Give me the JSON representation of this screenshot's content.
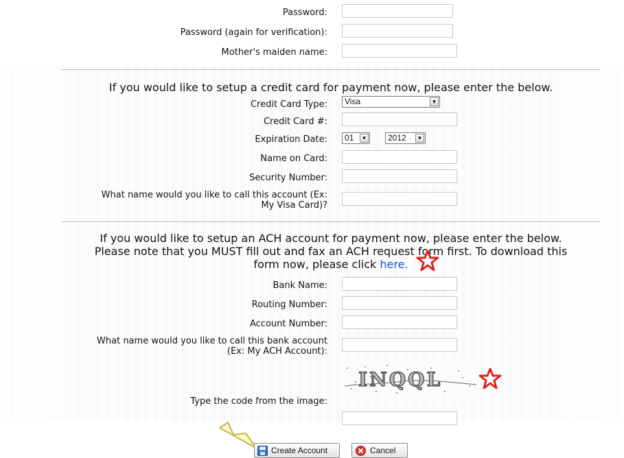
{
  "account": {
    "password_label": "Password:",
    "password_again_label": "Password (again for verification):",
    "maiden_label": "Mother's maiden name:"
  },
  "credit_card": {
    "intro": "If you would like to setup a credit card for payment now, please enter the below.",
    "type_label": "Credit Card Type:",
    "type_value": "Visa",
    "number_label": "Credit Card #:",
    "expiration_label": "Expiration Date:",
    "exp_month": "01",
    "exp_year": "2012",
    "name_label": "Name on Card:",
    "security_label": "Security Number:",
    "nickname_label_line1": "What name would you like to call this account (Ex:",
    "nickname_label_line2": "My Visa Card)?"
  },
  "ach": {
    "intro_line1": "If you would like to setup an ACH account for payment now, please enter the below.",
    "intro_line2": "Please note that you MUST fill out and fax an ACH request form first. To download this",
    "intro_line3_prefix": "form now, please click",
    "intro_link": "here.",
    "bank_label": "Bank Name:",
    "routing_label": "Routing Number:",
    "account_label": "Account Number:",
    "nickname_label_line1": "What name would you like to call this bank account",
    "nickname_label_line2": "(Ex: My ACH Account):"
  },
  "captcha": {
    "code_text": "INQQL",
    "label": "Type the code from the image:"
  },
  "buttons": {
    "create": "Create Account",
    "cancel": "Cancel"
  },
  "colors": {
    "link": "#1a4fd0",
    "star_fill": "#ffffff",
    "star_stroke": "#e02020",
    "cancel_icon": "#d8302b",
    "save_icon": "#2f6fc0"
  }
}
